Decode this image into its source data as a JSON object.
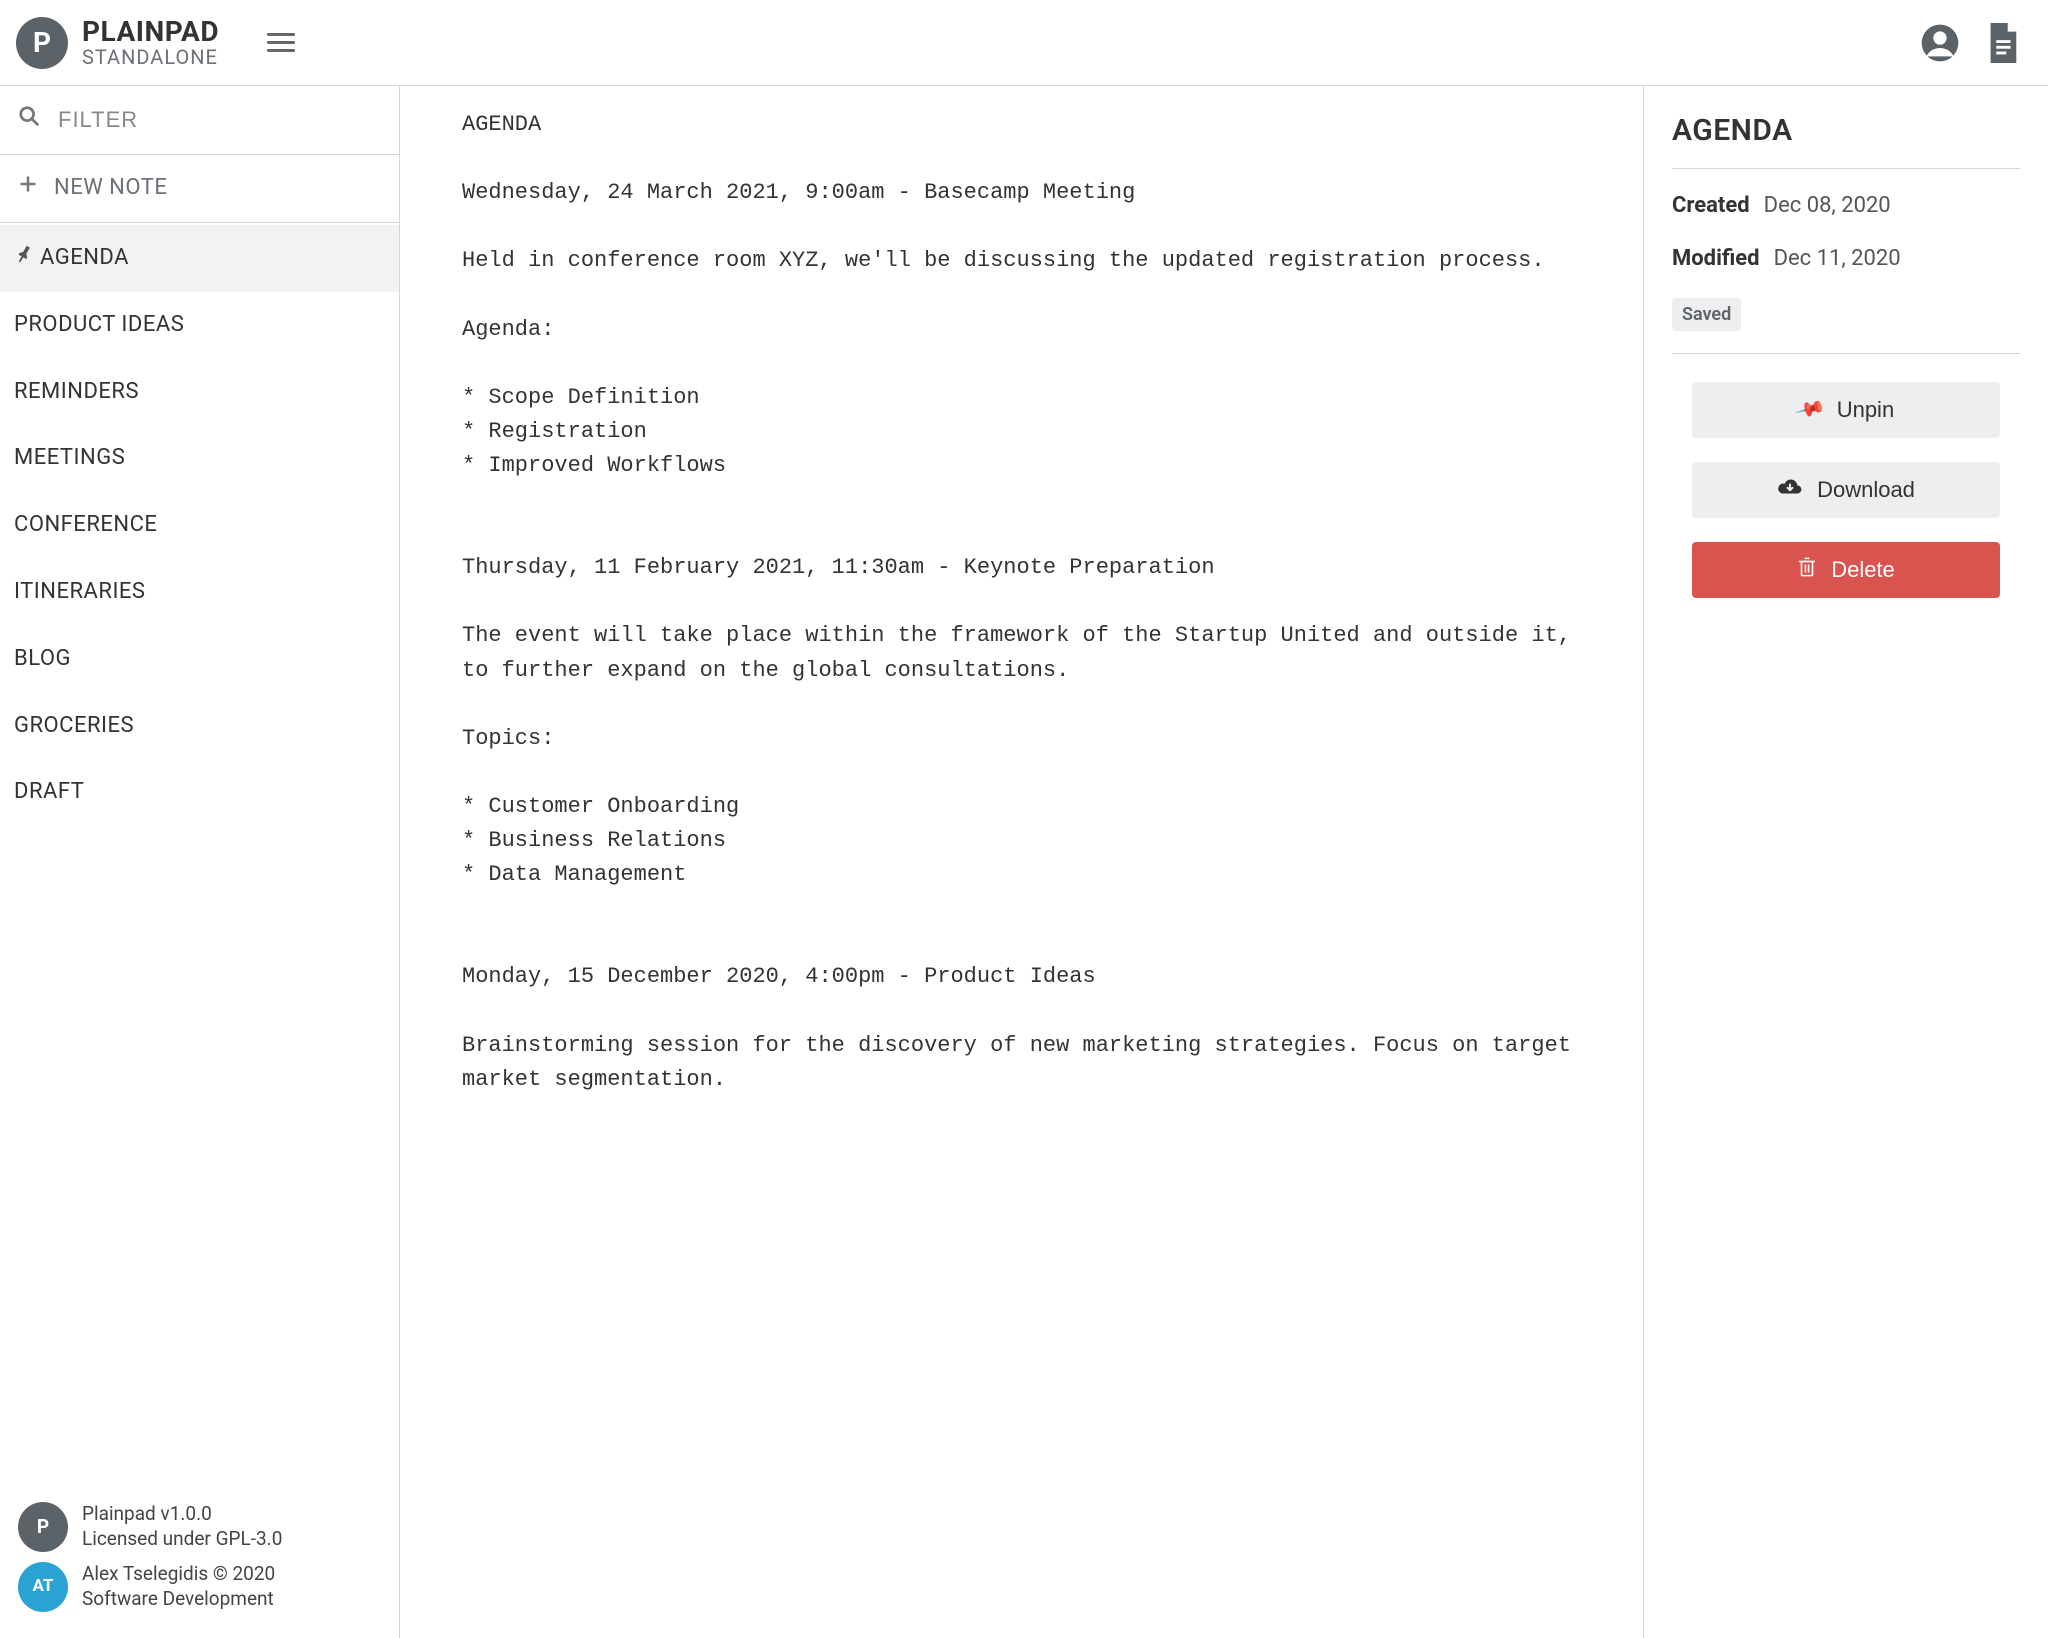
{
  "header": {
    "logo_letter": "P",
    "title": "PLAINPAD",
    "subtitle": "STANDALONE"
  },
  "sidebar": {
    "filter_placeholder": "FILTER",
    "new_note_label": "NEW NOTE",
    "notes": [
      {
        "label": "AGENDA",
        "pinned": true,
        "active": true
      },
      {
        "label": "PRODUCT IDEAS",
        "pinned": false,
        "active": false
      },
      {
        "label": "REMINDERS",
        "pinned": false,
        "active": false
      },
      {
        "label": "MEETINGS",
        "pinned": false,
        "active": false
      },
      {
        "label": "CONFERENCE",
        "pinned": false,
        "active": false
      },
      {
        "label": "ITINERARIES",
        "pinned": false,
        "active": false
      },
      {
        "label": "BLOG",
        "pinned": false,
        "active": false
      },
      {
        "label": "GROCERIES",
        "pinned": false,
        "active": false
      },
      {
        "label": "DRAFT",
        "pinned": false,
        "active": false
      }
    ],
    "footer": {
      "line1a": "Plainpad ",
      "line1b": "v1.0.0",
      "line2a": "Licensed under ",
      "line2b": "GPL-3.0",
      "line3a": "Alex Tselegidis ",
      "line3b": "© 2020",
      "line4": "Software Development"
    }
  },
  "editor": {
    "content": "AGENDA\n\nWednesday, 24 March 2021, 9:00am - Basecamp Meeting\n\nHeld in conference room XYZ, we'll be discussing the updated registration process.\n\nAgenda:\n\n* Scope Definition\n* Registration\n* Improved Workflows\n\n\nThursday, 11 February 2021, 11:30am - Keynote Preparation\n\nThe event will take place within the framework of the Startup United and outside it, to further expand on the global consultations.\n\nTopics:\n\n* Customer Onboarding\n* Business Relations\n* Data Management\n\n\nMonday, 15 December 2020, 4:00pm - Product Ideas\n\nBrainstorming session for the discovery of new marketing strategies. Focus on target market segmentation."
  },
  "props": {
    "title": "AGENDA",
    "created_label": "Created",
    "created_value": "Dec 08, 2020",
    "modified_label": "Modified",
    "modified_value": "Dec 11, 2020",
    "saved_badge": "Saved",
    "actions": {
      "unpin": "Unpin",
      "download": "Download",
      "delete": "Delete"
    }
  }
}
